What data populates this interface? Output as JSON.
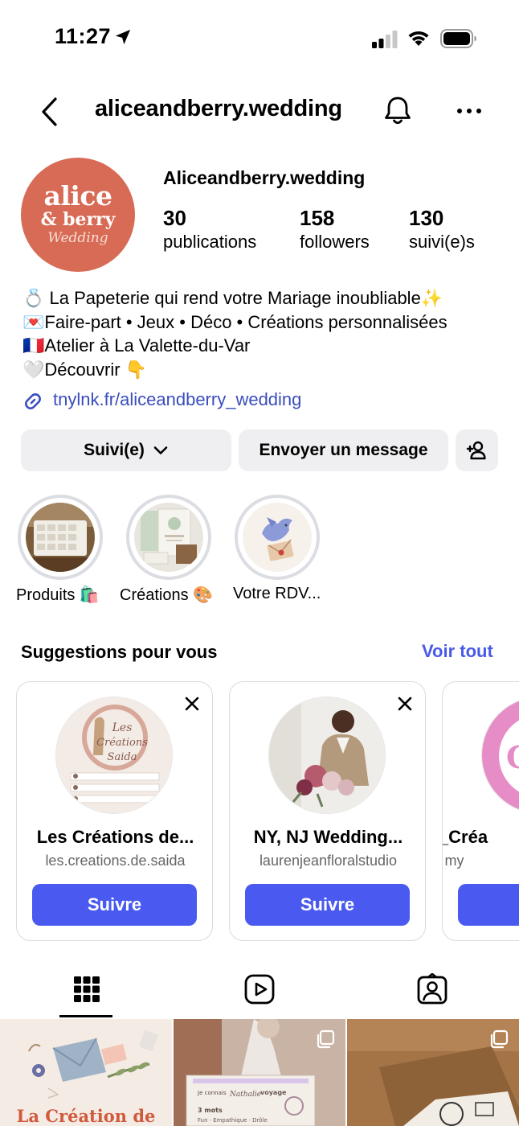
{
  "status_bar": {
    "time": "11:27",
    "icons": [
      "location-arrow-icon",
      "cellular-signal-icon",
      "wifi-icon",
      "battery-icon"
    ]
  },
  "header": {
    "title": "aliceandberry.wedding",
    "icons": [
      "back-chevron-icon",
      "bell-icon",
      "more-horizontal-icon"
    ]
  },
  "profile": {
    "avatar_text": {
      "line1": "alice",
      "line2": "& berry",
      "line3": "Wedding"
    },
    "name": "Aliceandberry.wedding",
    "stats": [
      {
        "value": "30",
        "label": "publications"
      },
      {
        "value": "158",
        "label": "followers"
      },
      {
        "value": "130",
        "label": "suivi(e)s"
      }
    ],
    "bio": [
      "💍 La Papeterie qui rend votre Mariage inoubliable✨",
      "💌Faire-part • Jeux • Déco • Créations personnalisées",
      "🇫🇷Atelier à La Valette-du-Var",
      "🤍Découvrir 👇"
    ],
    "link": "tnylnk.fr/aliceandberry_wedding"
  },
  "actions": {
    "following_label": "Suivi(e)",
    "message_label": "Envoyer un message"
  },
  "highlights": [
    {
      "label": "Produits 🛍️"
    },
    {
      "label": "Créations 🎨"
    },
    {
      "label": "Votre RDV..."
    }
  ],
  "suggestions": {
    "title": "Suggestions pour vous",
    "see_all": "Voir tout",
    "cards": [
      {
        "name": "Les Créations de...",
        "handle": "les.creations.de.saida",
        "button": "Suivre"
      },
      {
        "name": "NY, NJ Wedding...",
        "handle": "laurenjeanfloralstudio",
        "button": "Suivre"
      },
      {
        "name": "IR_Créa",
        "handle": "my",
        "button": "S"
      }
    ]
  },
  "tabs": [
    {
      "icon": "grid-icon",
      "active": true
    },
    {
      "icon": "reels-icon",
      "active": false
    },
    {
      "icon": "tagged-icon",
      "active": false
    }
  ],
  "posts": [
    {
      "caption": "La Création de"
    }
  ],
  "colors": {
    "accent": "#4a5af0",
    "link": "#3a4dbd",
    "avatar_bg": "#d86b55",
    "button_bg": "#efeff1"
  }
}
